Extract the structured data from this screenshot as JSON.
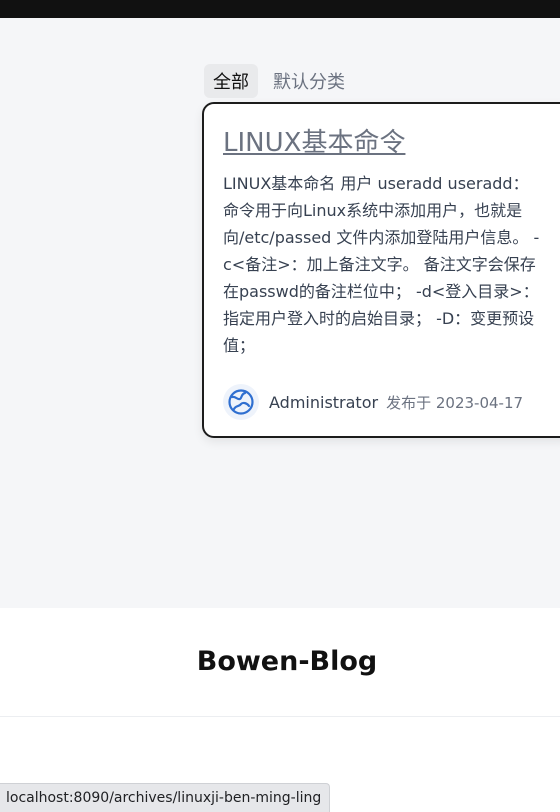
{
  "tabs": [
    {
      "label": "全部",
      "active": true
    },
    {
      "label": "默认分类",
      "active": false
    }
  ],
  "post": {
    "title": "LINUX基本命令",
    "excerpt": "LINUX基本命名 用户 useradd useradd： 命令用于向Linux系统中添加用户，也就是向/etc/passed 文件内添加登陆用户信息。 -c<备注>：加上备注文字。 备注文字会保存在passwd的备注栏位中； -d<登入目录>：指定用户登入时的启始目录； -D：变更预设值；",
    "author": "Administrator",
    "published_prefix": "发布于",
    "published_date": "2023-04-17",
    "avatar_icon": "globe-icon"
  },
  "footer": {
    "site_title": "Bowen-Blog"
  },
  "status_url": "localhost:8090/archives/linuxji-ben-ming-ling",
  "colors": {
    "accent": "#2f6fd0",
    "topbar": "#111111",
    "background": "#f5f6f8"
  }
}
